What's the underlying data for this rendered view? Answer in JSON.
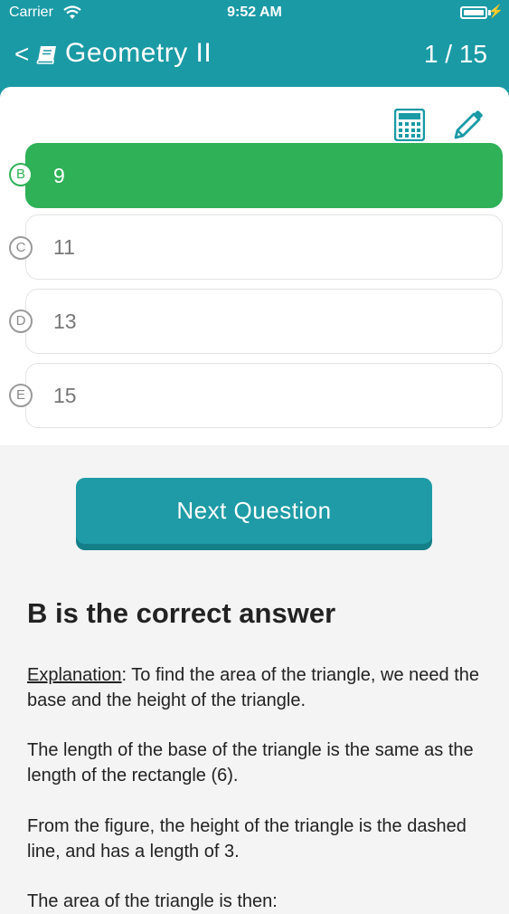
{
  "status_bar": {
    "carrier": "Carrier",
    "time": "9:52 AM",
    "charging_symbol": "⚡"
  },
  "nav": {
    "back_symbol": "<",
    "title": "Geometry II",
    "count": "1 / 15"
  },
  "tools": {
    "calculator_icon": "calculator-icon",
    "pencil_icon": "pencil-icon"
  },
  "options": [
    {
      "letter": "B",
      "text": "9",
      "selected": true
    },
    {
      "letter": "C",
      "text": "11",
      "selected": false
    },
    {
      "letter": "D",
      "text": "13",
      "selected": false
    },
    {
      "letter": "E",
      "text": "15",
      "selected": false
    }
  ],
  "next_button": "Next Question",
  "result_title": "B is the correct answer",
  "explanation": {
    "label": "Explanation",
    "p1_rest": ": To find the area of the triangle, we need the base and the height of the triangle.",
    "p2": "The length of the base of the triangle is the same as the length of the rectangle (6).",
    "p3": "From the figure, the height of the triangle is the dashed line, and has a length of 3.",
    "p4": "The area of the triangle is then:"
  },
  "colors": {
    "header": "#1a9aa5",
    "selected": "#2fb157",
    "button": "#1e9ba6"
  }
}
